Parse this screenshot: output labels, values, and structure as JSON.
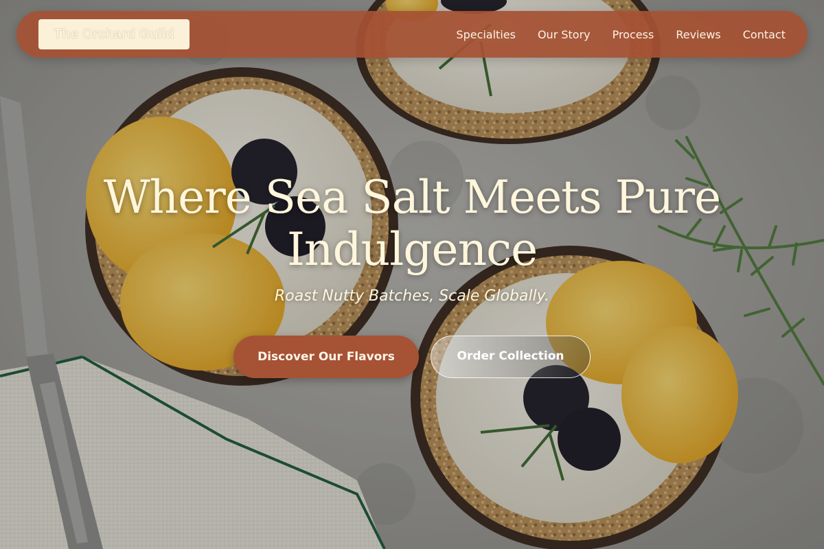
{
  "nav": {
    "brand": "The Orchard Guild",
    "links": [
      "Specialties",
      "Our Story",
      "Process",
      "Reviews",
      "Contact"
    ]
  },
  "hero": {
    "title": "Where Sea Salt Meets Pure Indulgence",
    "subtitle": "Roast Nutty Batches, Scale Globally.",
    "primary_cta": "Discover Our Flavors",
    "secondary_cta": "Order Collection"
  },
  "colors": {
    "nav_background": "#a65234",
    "brand_background": "#fbf1d9",
    "primary_button": "#a65234",
    "headline_text": "#fff6dc"
  },
  "background_image": "overhead photo of orange and blackberry cream tarts on a grey stone surface with rosemary sprigs, a linen napkin and a vintage knife"
}
